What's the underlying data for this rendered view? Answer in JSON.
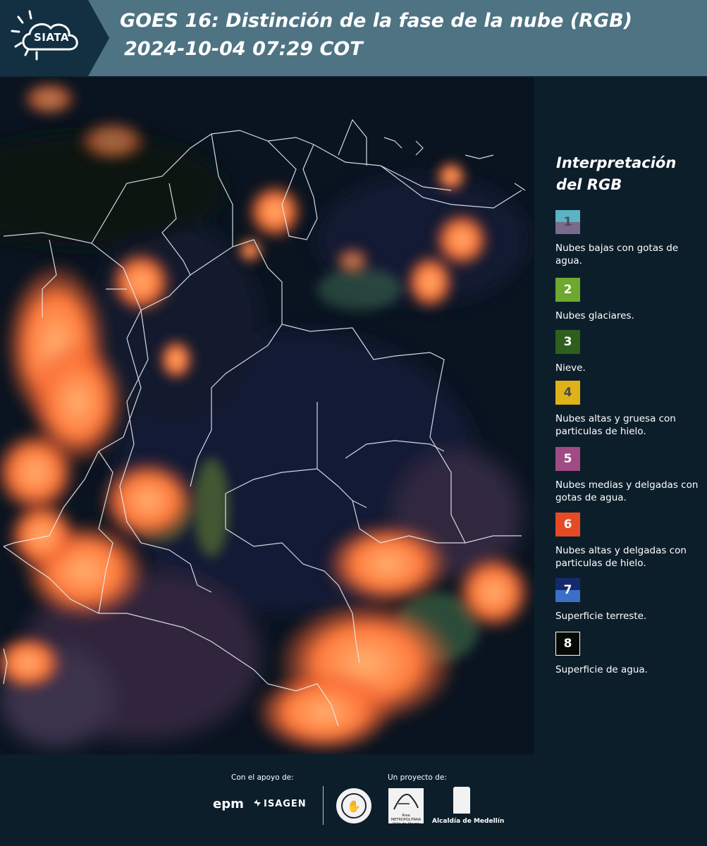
{
  "header": {
    "logo_text": "SIATA",
    "title_line1": "GOES 16: Distinción de la fase de la nube (RGB)",
    "title_line2": "2024-10-04 07:29 COT"
  },
  "legend": {
    "title_line1": "Interpretación",
    "title_line2": "del RGB",
    "items": [
      {
        "number": "1",
        "label": "Nubes bajas con gotas de agua.",
        "color_top": "#5bb3c4",
        "color_bottom": "#7a6a8c",
        "text_color": "#4a4a5a"
      },
      {
        "number": "2",
        "label": "Nubes glaciares.",
        "color": "#6ea82e",
        "text_color": "#ffffff"
      },
      {
        "number": "3",
        "label": "Nieve.",
        "color": "#2e5f1c",
        "text_color": "#ffffff"
      },
      {
        "number": "4",
        "label": "Nubes altas y gruesa con particulas de hielo.",
        "color": "#e0b219",
        "text_color": "#4a4a4a"
      },
      {
        "number": "5",
        "label": "Nubes medias y delgadas con gotas de agua.",
        "color": "#a04b84",
        "text_color": "#ffffff"
      },
      {
        "number": "6",
        "label": "Nubes altas y delgadas con particulas de hielo.",
        "color": "#e64a25",
        "text_color": "#ffffff"
      },
      {
        "number": "7",
        "label": "Superficie terreste.",
        "color_top": "#152a6e",
        "color_bottom": "#3c6fc8",
        "text_color": "#ffffff"
      },
      {
        "number": "8",
        "label": "Superficie de agua.",
        "color": "#050a05",
        "text_color": "#ffffff",
        "border": "#ffffff"
      }
    ]
  },
  "footer": {
    "support_label": "Con el apoyo de:",
    "project_label": "Un proyecto de:",
    "epm": "epm",
    "isagen": "ISAGEN",
    "amva": "Área METROPOLITANA Valle de Aburrá",
    "medellin": "Alcaldía de Medellín"
  }
}
